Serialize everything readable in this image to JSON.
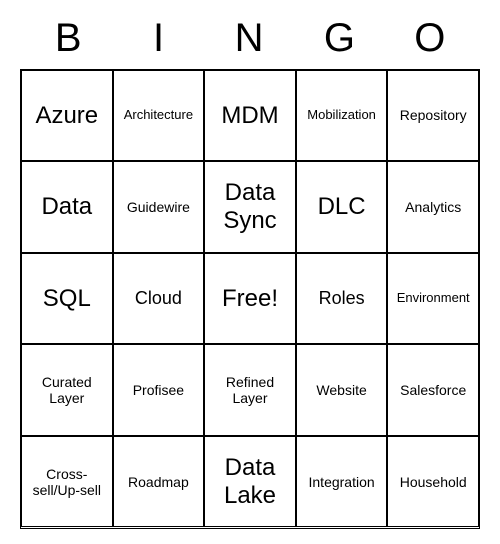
{
  "header": [
    "B",
    "I",
    "N",
    "G",
    "O"
  ],
  "cells": [
    [
      {
        "text": "Azure",
        "size": "large"
      },
      {
        "text": "Architecture",
        "size": "xsmall"
      },
      {
        "text": "MDM",
        "size": "large"
      },
      {
        "text": "Mobilization",
        "size": "xsmall"
      },
      {
        "text": "Repository",
        "size": "small"
      }
    ],
    [
      {
        "text": "Data",
        "size": "large"
      },
      {
        "text": "Guidewire",
        "size": "small"
      },
      {
        "text": "Data Sync",
        "size": "large"
      },
      {
        "text": "DLC",
        "size": "large"
      },
      {
        "text": "Analytics",
        "size": "small"
      }
    ],
    [
      {
        "text": "SQL",
        "size": "large"
      },
      {
        "text": "Cloud",
        "size": "med"
      },
      {
        "text": "Free!",
        "size": "large"
      },
      {
        "text": "Roles",
        "size": "med"
      },
      {
        "text": "Environment",
        "size": "xsmall"
      }
    ],
    [
      {
        "text": "Curated Layer",
        "size": "small"
      },
      {
        "text": "Profisee",
        "size": "small"
      },
      {
        "text": "Refined Layer",
        "size": "small"
      },
      {
        "text": "Website",
        "size": "small"
      },
      {
        "text": "Salesforce",
        "size": "small"
      }
    ],
    [
      {
        "text": "Cross-sell/Up-sell",
        "size": "small"
      },
      {
        "text": "Roadmap",
        "size": "small"
      },
      {
        "text": "Data Lake",
        "size": "large"
      },
      {
        "text": "Integration",
        "size": "small"
      },
      {
        "text": "Household",
        "size": "small"
      }
    ]
  ]
}
